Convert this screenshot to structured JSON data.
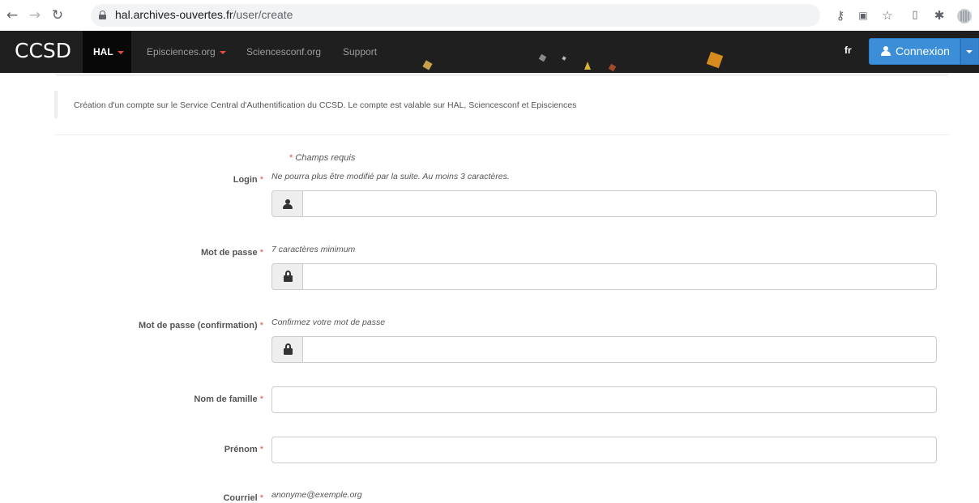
{
  "browser": {
    "url_host": "hal.archives-ouvertes.fr",
    "url_path": "/user/create"
  },
  "navbar": {
    "logo": "CCSD",
    "items": [
      {
        "label": "HAL",
        "dropdown": true,
        "active": true
      },
      {
        "label": "Episciences.org",
        "dropdown": true,
        "active": false
      },
      {
        "label": "Sciencesconf.org",
        "dropdown": false,
        "active": false
      },
      {
        "label": "Support",
        "dropdown": false,
        "active": false
      }
    ],
    "language": "fr",
    "login_button": "Connexion"
  },
  "info_text": "Création d'un compte sur le Service Central d'Authentification du CCSD. Le compte est valable sur HAL, Sciencesconf et Episciences",
  "required_note": "Champs requis",
  "form": {
    "login": {
      "label": "Login",
      "help": "Ne pourra plus être modifié par la suite. Au moins 3 caractères.",
      "icon": "user-icon",
      "value": ""
    },
    "password": {
      "label": "Mot de passe",
      "help": "7 caractères minimum",
      "icon": "lock-icon",
      "value": ""
    },
    "password_confirm": {
      "label": "Mot de passe (confirmation)",
      "help": "Confirmez votre mot de passe",
      "icon": "lock-icon",
      "value": ""
    },
    "lastname": {
      "label": "Nom de famille",
      "value": ""
    },
    "firstname": {
      "label": "Prénom",
      "value": ""
    },
    "email": {
      "label": "Courriel",
      "help": "anonyme@exemple.org"
    }
  },
  "colors": {
    "navbar_bg": "#1f1f1f",
    "accent": "#3d8ed8",
    "required_star": "#e74c3c"
  }
}
